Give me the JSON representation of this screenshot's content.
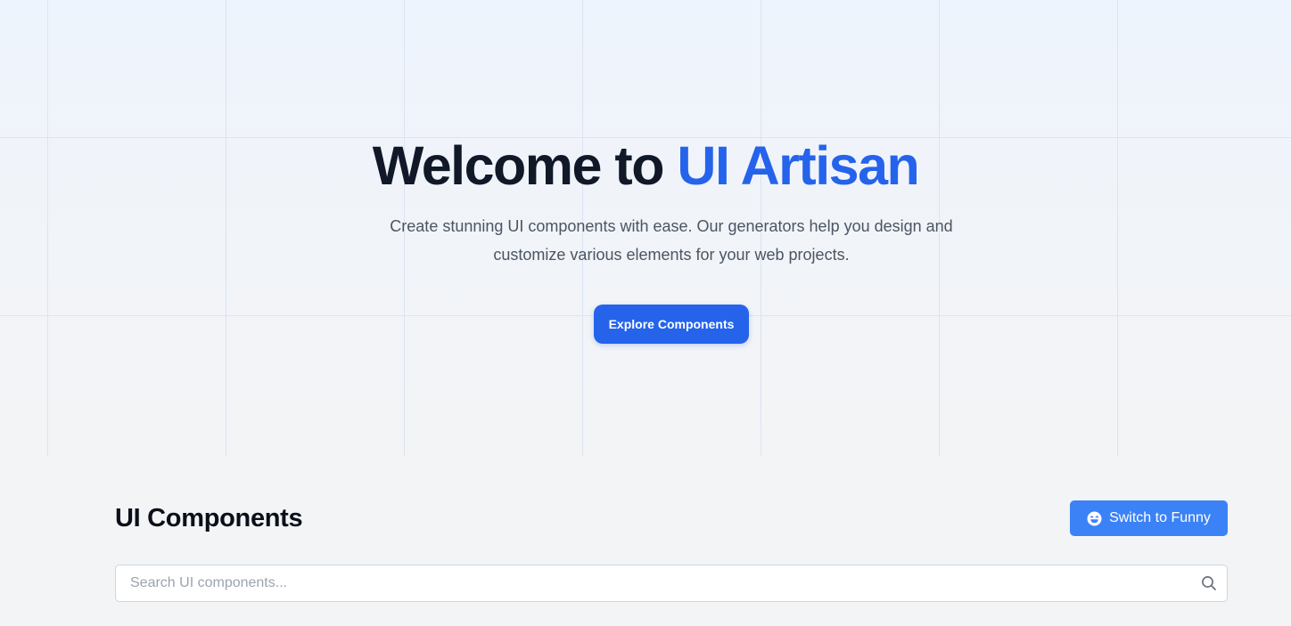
{
  "hero": {
    "title_main": "Welcome to ",
    "title_accent": "UI Artisan",
    "subtitle": "Create stunning UI components with ease. Our generators help you design and customize various elements for your web projects.",
    "cta_label": "Explore Components"
  },
  "components": {
    "section_title": "UI Components",
    "switch_label": "Switch to Funny",
    "switch_icon": "laughing-face-icon",
    "search_placeholder": "Search UI components...",
    "search_value": "",
    "search_icon": "search-icon"
  },
  "colors": {
    "accent": "#2563eb",
    "switch_button": "#3b82f6",
    "background": "#f3f4f6",
    "title": "#111827",
    "subtitle": "#4b5563"
  }
}
